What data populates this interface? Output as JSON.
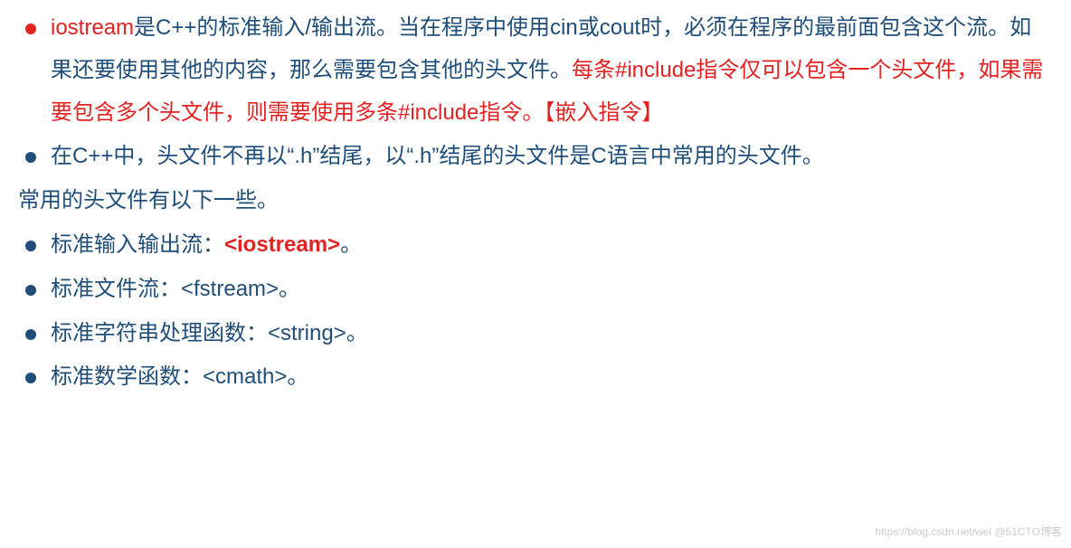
{
  "bullet1": {
    "part1_red": "iostream",
    "part2": "是C++的标准输入/输出流。当在程序中使用cin或cout时，必须在程序的最前面包含这个流。如果还要使用其他的内容，那么需要包含其他的头文件。",
    "part3_red": "每条#include指令仅可以包含一个头文件，如果需要包含多个头文件，则需要使用多条#include指令。【嵌入指令】"
  },
  "bullet2": "在C++中，头文件不再以“.h”结尾，以“.h”结尾的头文件是C语言中常用的头文件。",
  "plain_line": "常用的头文件有以下一些。",
  "bullet3": {
    "prefix": "标准输入输出流：",
    "highlight": "<iostream>",
    "suffix": "。"
  },
  "bullet4": "标准文件流：<fstream>。",
  "bullet5": "标准字符串处理函数：<string>。",
  "bullet6": "标准数学函数：<cmath>。",
  "watermark": "https://blog.csdn.net/wei @51CTO博客"
}
